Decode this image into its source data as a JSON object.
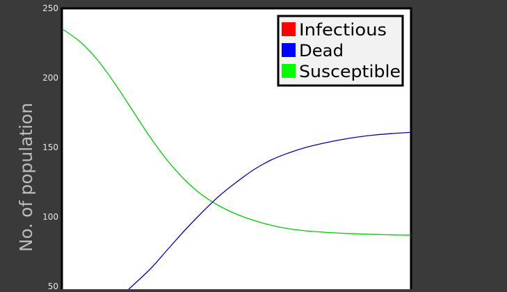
{
  "chart_data": {
    "type": "line",
    "ylabel": "No. of population",
    "ylim": [
      50,
      250
    ],
    "yticks": [
      250,
      200,
      150,
      100,
      50
    ],
    "xlim": [
      0,
      1
    ],
    "grid": false,
    "legend_position": "top-right",
    "legend": [
      {
        "name": "Infectious",
        "color": "#ff0000"
      },
      {
        "name": "Dead",
        "color": "#0000ff"
      },
      {
        "name": "Susceptible",
        "color": "#00ff00"
      }
    ],
    "series": [
      {
        "name": "Susceptible",
        "color": "#00cc00",
        "x": [
          0.0,
          0.05,
          0.1,
          0.15,
          0.2,
          0.25,
          0.3,
          0.35,
          0.4,
          0.45,
          0.5,
          0.55,
          0.6,
          0.65,
          0.7,
          0.75,
          0.8,
          0.85,
          0.9,
          0.95,
          1.0
        ],
        "y": [
          235,
          226,
          213,
          196,
          177,
          158,
          141,
          127,
          116,
          108,
          102,
          97.5,
          94,
          91.5,
          90,
          89,
          88.3,
          87.8,
          87.4,
          87.1,
          86.9
        ]
      },
      {
        "name": "Dead",
        "color": "#0000b4",
        "x": [
          0.19,
          0.25,
          0.3,
          0.35,
          0.4,
          0.45,
          0.5,
          0.55,
          0.6,
          0.65,
          0.7,
          0.75,
          0.8,
          0.85,
          0.9,
          0.95,
          1.0
        ],
        "y": [
          48,
          62,
          76,
          90,
          103,
          115,
          125,
          134,
          141,
          146,
          150,
          153,
          155.5,
          157.5,
          159,
          160,
          160.8
        ]
      }
    ]
  }
}
